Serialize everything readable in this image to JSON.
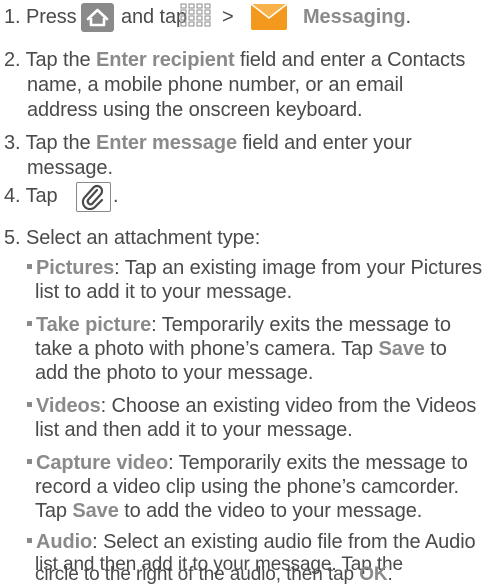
{
  "step1": {
    "num": "1.",
    "press": "Press",
    "and_tap": "and tap",
    "gt": ">",
    "messaging": "Messaging",
    "period": "."
  },
  "step2": {
    "num": "2.",
    "tap": "Tap the",
    "field": "Enter recipient",
    "rest1": "field and enter a Contacts",
    "line2": "name, a mobile phone number, or an email",
    "line3": "address using the onscreen keyboard."
  },
  "step3": {
    "num": "3.",
    "tap": "Tap the",
    "field": "Enter message",
    "rest1": "field and enter your",
    "line2": "message."
  },
  "step4": {
    "num": "4.",
    "tap": "Tap",
    "period": "."
  },
  "step5": {
    "num": "5.",
    "text": "Select an attachment type:"
  },
  "bullets": [
    {
      "label": "Pictures",
      "lines": [
        ": Tap an existing image from your Pictures",
        "list to add it to your message."
      ]
    },
    {
      "label": "Take picture",
      "lines": [
        ": Temporarily exits the message to",
        "take a photo with phone’s camera. Tap",
        "Save",
        "to",
        "add the photo to your message."
      ]
    },
    {
      "label": "Videos",
      "lines": [
        ": Choose an existing video from the Videos",
        "list and then add it to your message."
      ]
    },
    {
      "label": "Capture video",
      "lines": [
        ": Temporarily exits the message to",
        "record a video clip using the phone’s camcorder.",
        "Tap",
        "Save",
        "to add the video to your message."
      ]
    },
    {
      "label": "Audio",
      "lines": [
        ": Select an existing audio file from the Audio",
        "list and then add it to your message. Tap the",
        "circle to the right of the audio, then tap",
        "OK",
        "."
      ]
    }
  ],
  "icons": {
    "home": "home-icon",
    "apps": "apps-grid-icon",
    "messaging": "messaging-app-icon",
    "attach": "paperclip-icon"
  },
  "colors": {
    "text": "#4a4a4a",
    "keyword": "#8a8a8a",
    "msg_orange": "#f39a1e"
  }
}
